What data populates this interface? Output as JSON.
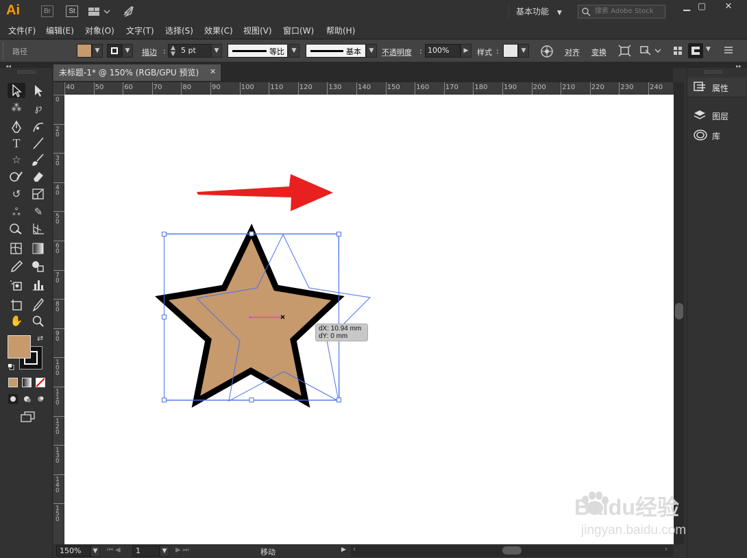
{
  "app": {
    "logo": "Ai",
    "bridge_chip": "Br",
    "stock_chip": "St",
    "workspace": "基本功能",
    "stock_search_placeholder": "搜索 Adobe Stock"
  },
  "menu": [
    "文件(F)",
    "编辑(E)",
    "对象(O)",
    "文字(T)",
    "选择(S)",
    "效果(C)",
    "视图(V)",
    "窗口(W)",
    "帮助(H)"
  ],
  "control": {
    "selection_type": "路径",
    "fill_color": "#c69a6c",
    "stroke_label": "描边",
    "stroke_weight": "5 pt",
    "stroke_profile": "等比",
    "brush_definition": "基本",
    "opacity_label": "不透明度",
    "opacity_value": "100%",
    "style_label": "样式",
    "align_label": "对齐",
    "transform_label": "变换"
  },
  "document": {
    "tab_title": "未标题-1* @ 150% (RGB/GPU 预览)",
    "close": "✕"
  },
  "ruler": {
    "h_ticks": [
      "40",
      "50",
      "60",
      "70",
      "80",
      "90",
      "100",
      "110",
      "120",
      "130",
      "140",
      "150",
      "160",
      "170",
      "180",
      "190",
      "200",
      "210",
      "220",
      "230",
      "240"
    ],
    "v_ticks": [
      "0",
      "2 0",
      "3 0",
      "4 0",
      "5 0",
      "6 0",
      "7 0",
      "8 0",
      "9 0",
      "1 0 0",
      "1 1 0",
      "1 2 0",
      "1 3 0",
      "1 4 0",
      "1 5 0"
    ]
  },
  "canvas": {
    "star_fill": "#c69a6c",
    "star_stroke": "#000000",
    "selection_color": "#4a73e8",
    "arrow_color": "#e8201f",
    "drag_line_color": "#e040c8",
    "tooltip_dx": "dX: 10.94 mm",
    "tooltip_dy": "dY: 0 mm"
  },
  "right_panel": {
    "items": [
      {
        "label": "属性",
        "icon": "properties-icon"
      },
      {
        "label": "图层",
        "icon": "layers-icon"
      },
      {
        "label": "库",
        "icon": "libraries-icon"
      }
    ]
  },
  "status": {
    "zoom": "150%",
    "artboard": "1",
    "current_tool": "移动"
  },
  "watermark": {
    "brand": "Baidu经验",
    "url": "jingyan.baidu.com"
  }
}
